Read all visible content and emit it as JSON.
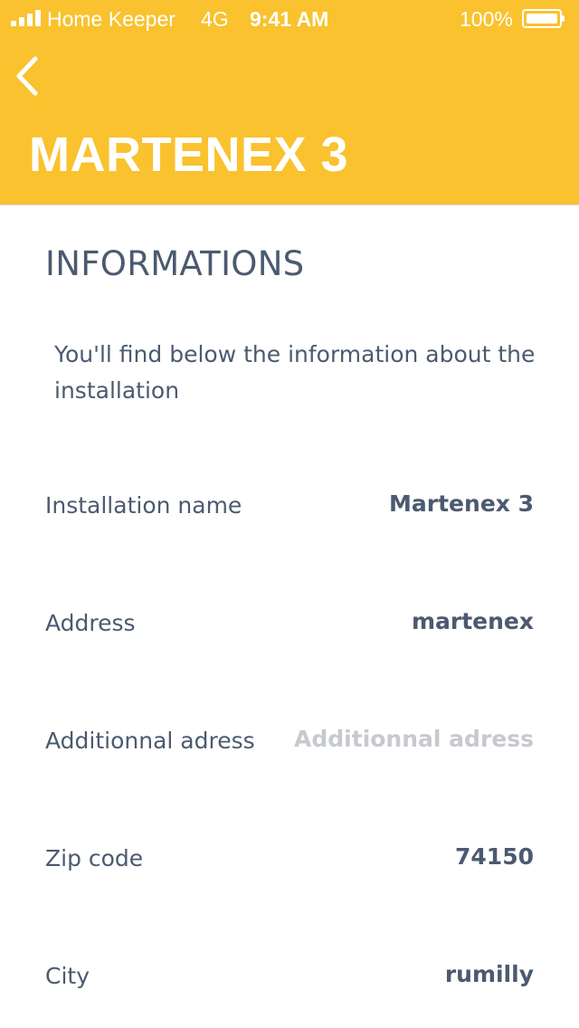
{
  "status_bar": {
    "carrier": "Home Keeper",
    "network": "4G",
    "time": "9:41 AM",
    "battery_percent": "100%",
    "signal_icon": "cellular-signal-icon",
    "battery_icon": "battery-full-icon"
  },
  "header": {
    "back_icon": "chevron-left-icon",
    "title": "MARTENEX 3",
    "background_color": "#f9c22e"
  },
  "section": {
    "title": "INFORMATIONS",
    "intro": "You'll find below the information about the installation"
  },
  "fields": [
    {
      "label": "Installation name",
      "value": "Martenex 3",
      "placeholder": ""
    },
    {
      "label": "Address",
      "value": "martenex",
      "placeholder": ""
    },
    {
      "label": "Additionnal adress",
      "value": "",
      "placeholder": "Additionnal adress"
    },
    {
      "label": "Zip code",
      "value": "74150",
      "placeholder": ""
    },
    {
      "label": "City",
      "value": "rumilly",
      "placeholder": ""
    }
  ],
  "colors": {
    "accent": "#f9c22e",
    "text": "#4b5a70",
    "placeholder_text": "#c6c9ce"
  }
}
